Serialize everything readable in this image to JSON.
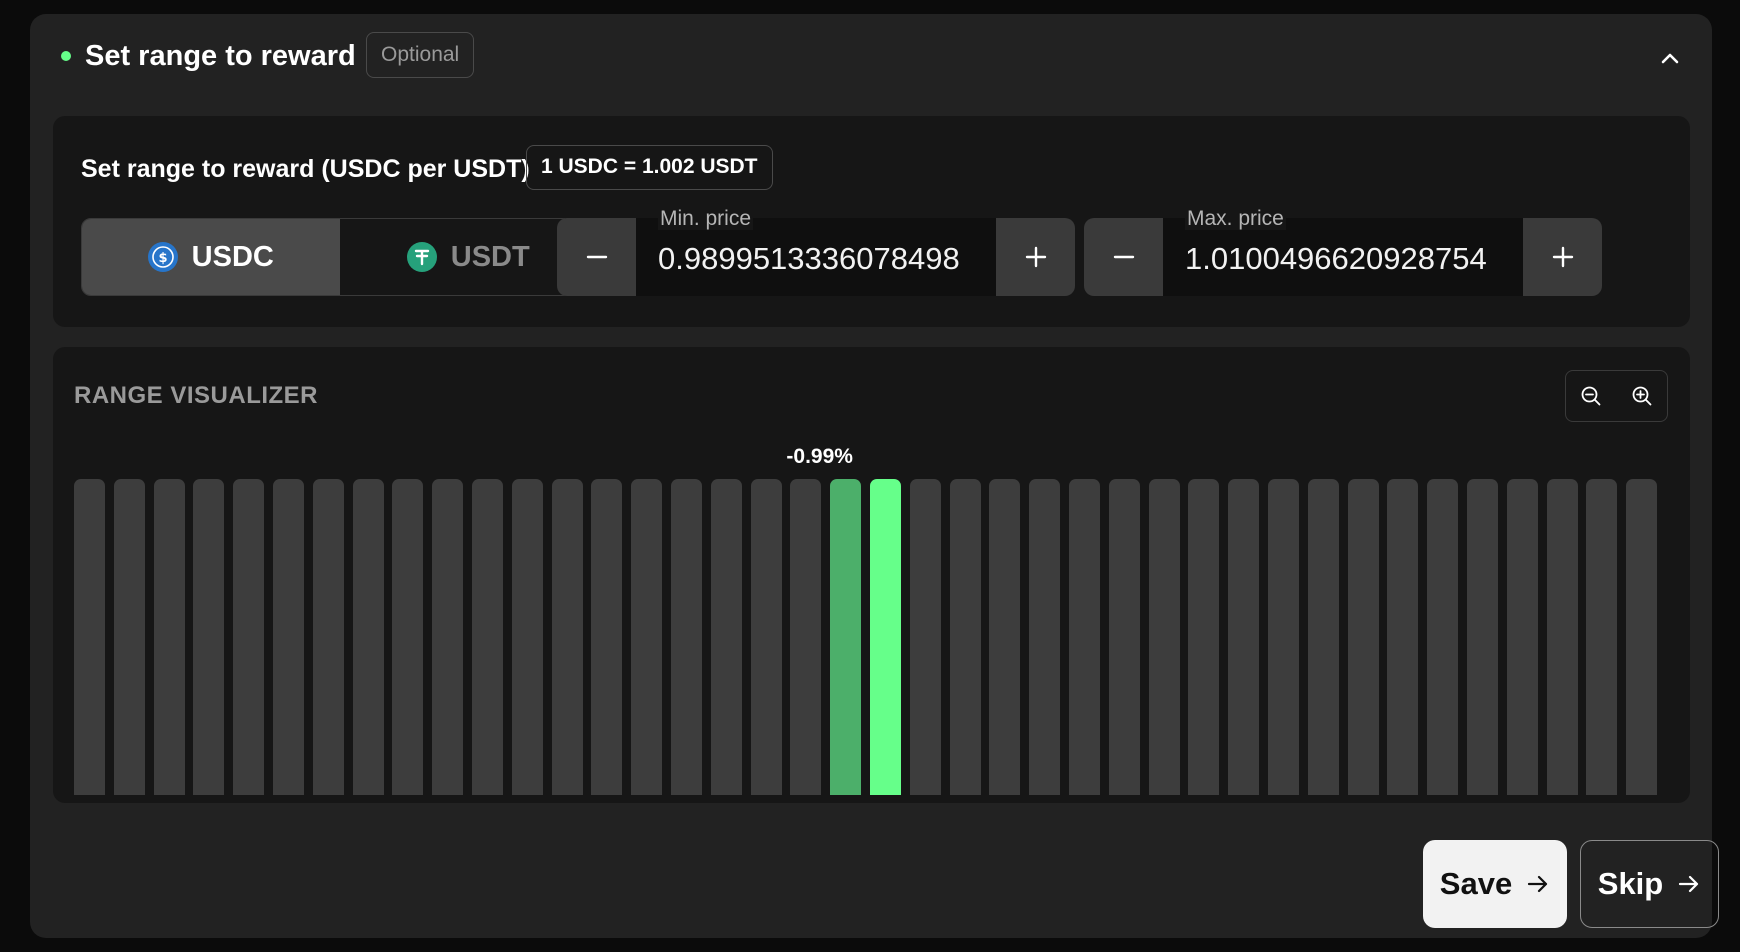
{
  "header": {
    "title": "Set range to reward",
    "badge": "Optional",
    "status_color": "#66ff8a"
  },
  "range": {
    "label": "Set range to reward (USDC per USDT)",
    "rate": "1 USDC = 1.002 USDT",
    "tokens": [
      {
        "symbol": "USDC",
        "icon": "usdc-icon",
        "color": "#2775ca",
        "selected": true
      },
      {
        "symbol": "USDT",
        "icon": "usdt-icon",
        "color": "#26a17b",
        "selected": false
      }
    ],
    "min_price": {
      "label": "Min. price",
      "value": "0.9899513336078498"
    },
    "max_price": {
      "label": "Max. price",
      "value": "1.0100496620928754"
    }
  },
  "visualizer": {
    "title": "RANGE VISUALIZER",
    "bar_count": 40,
    "highlighted_bars": [
      {
        "index": 19,
        "color": "#4caf6a"
      },
      {
        "index": 20,
        "color": "#66ff8a"
      }
    ],
    "current_label": "-0.99%",
    "zoom_out_icon": "zoom-out-icon",
    "zoom_in_icon": "zoom-in-icon"
  },
  "actions": {
    "save_label": "Save",
    "skip_label": "Skip"
  }
}
